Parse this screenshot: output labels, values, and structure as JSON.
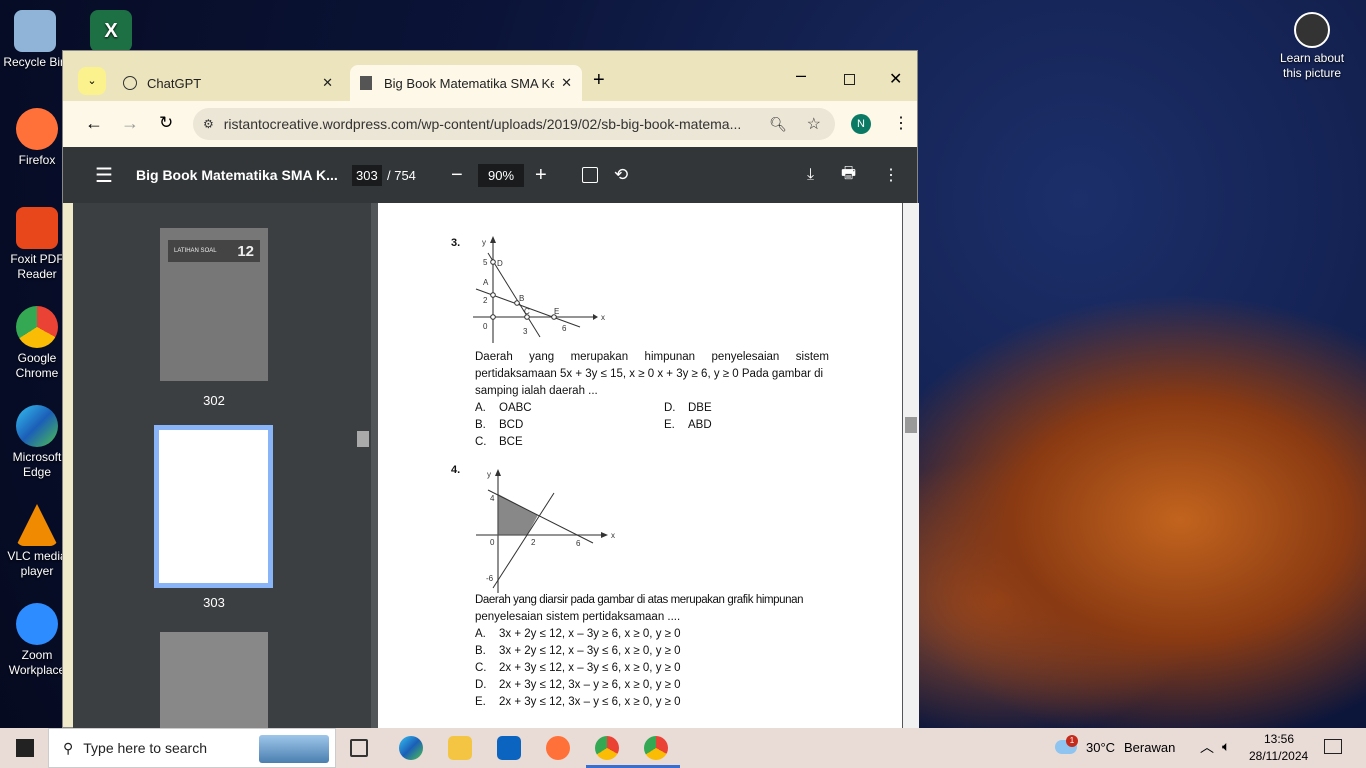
{
  "desktop": {
    "icons": [
      {
        "label": "Recycle Bin",
        "color": "#8fb4d8"
      },
      {
        "label": "Firefox",
        "color": "#ff7139"
      },
      {
        "label": "Foxit PDF Reader",
        "color": "#e8471c"
      },
      {
        "label": "Google Chrome",
        "color": "#4285f4"
      },
      {
        "label": "Microsoft Edge",
        "color": "#1f9bd8"
      },
      {
        "label": "VLC media player",
        "color": "#f08a00"
      },
      {
        "label": "Zoom Workplace",
        "color": "#2d8cff"
      }
    ],
    "excel_label": "X",
    "learn": "Learn about this picture"
  },
  "browser": {
    "tabs": [
      {
        "title": "ChatGPT"
      },
      {
        "title": "Big Book Matematika SMA Kela"
      }
    ],
    "url": "ristantocreative.wordpress.com/wp-content/uploads/2019/02/sb-big-book-matema...",
    "profile": "N"
  },
  "pdf": {
    "title": "Big Book Matematika SMA K...",
    "page": "303",
    "total": "/ 754",
    "zoom": "90%",
    "thumbs": [
      {
        "label": "302",
        "header": "LATIHAN SOAL",
        "num": "12"
      },
      {
        "label": "303"
      }
    ]
  },
  "content": {
    "q3": {
      "num": "3.",
      "graph": {
        "y": "y",
        "x": "x",
        "labels": [
          "5",
          "D",
          "A",
          "2",
          "B",
          "C",
          "E",
          "0",
          "3",
          "6"
        ]
      },
      "text1": "Daerah yang merupakan himpunan penyelesaian sistem",
      "text2": "pertidaksamaan 5x + 3y ≤ 15, x ≥ 0 x + 3y  ≥ 6,  y ≥ 0 Pada gambar di",
      "text3": "samping ialah daerah ...",
      "options": [
        [
          "A.",
          "OABC"
        ],
        [
          "B.",
          "BCD"
        ],
        [
          "C.",
          "BCE"
        ],
        [
          "D.",
          "DBE"
        ],
        [
          "E.",
          "ABD"
        ]
      ]
    },
    "q4": {
      "num": "4.",
      "graph": {
        "y": "y",
        "x": "x",
        "labels": [
          "4",
          "0",
          "2",
          "6",
          "-6"
        ]
      },
      "text1": "Daerah yang diarsir pada gambar di atas merupakan grafik himpunan",
      "text2": "penyelesaian sistem pertidaksamaan ....",
      "options": [
        [
          "A.",
          "3x + 2y ≤ 12, x – 3y ≥ 6, x ≥ 0, y ≥ 0"
        ],
        [
          "B.",
          "3x + 2y ≤ 12, x – 3y ≤ 6, x ≥ 0, y ≥ 0"
        ],
        [
          "C.",
          "2x + 3y ≤ 12, x – 3y ≤ 6, x ≥ 0, y ≥ 0"
        ],
        [
          "D.",
          "2x + 3y ≤ 12, 3x – y ≥ 6, x ≥ 0, y ≥ 0"
        ],
        [
          "E.",
          "2x + 3y ≤ 12, 3x – y ≤ 6, x ≥ 0, y ≥ 0"
        ]
      ]
    }
  },
  "taskbar": {
    "search": "Type here to search",
    "temp": "30°C",
    "weather": "Berawan",
    "badge": "1",
    "time": "13:56",
    "date": "28/11/2024"
  }
}
